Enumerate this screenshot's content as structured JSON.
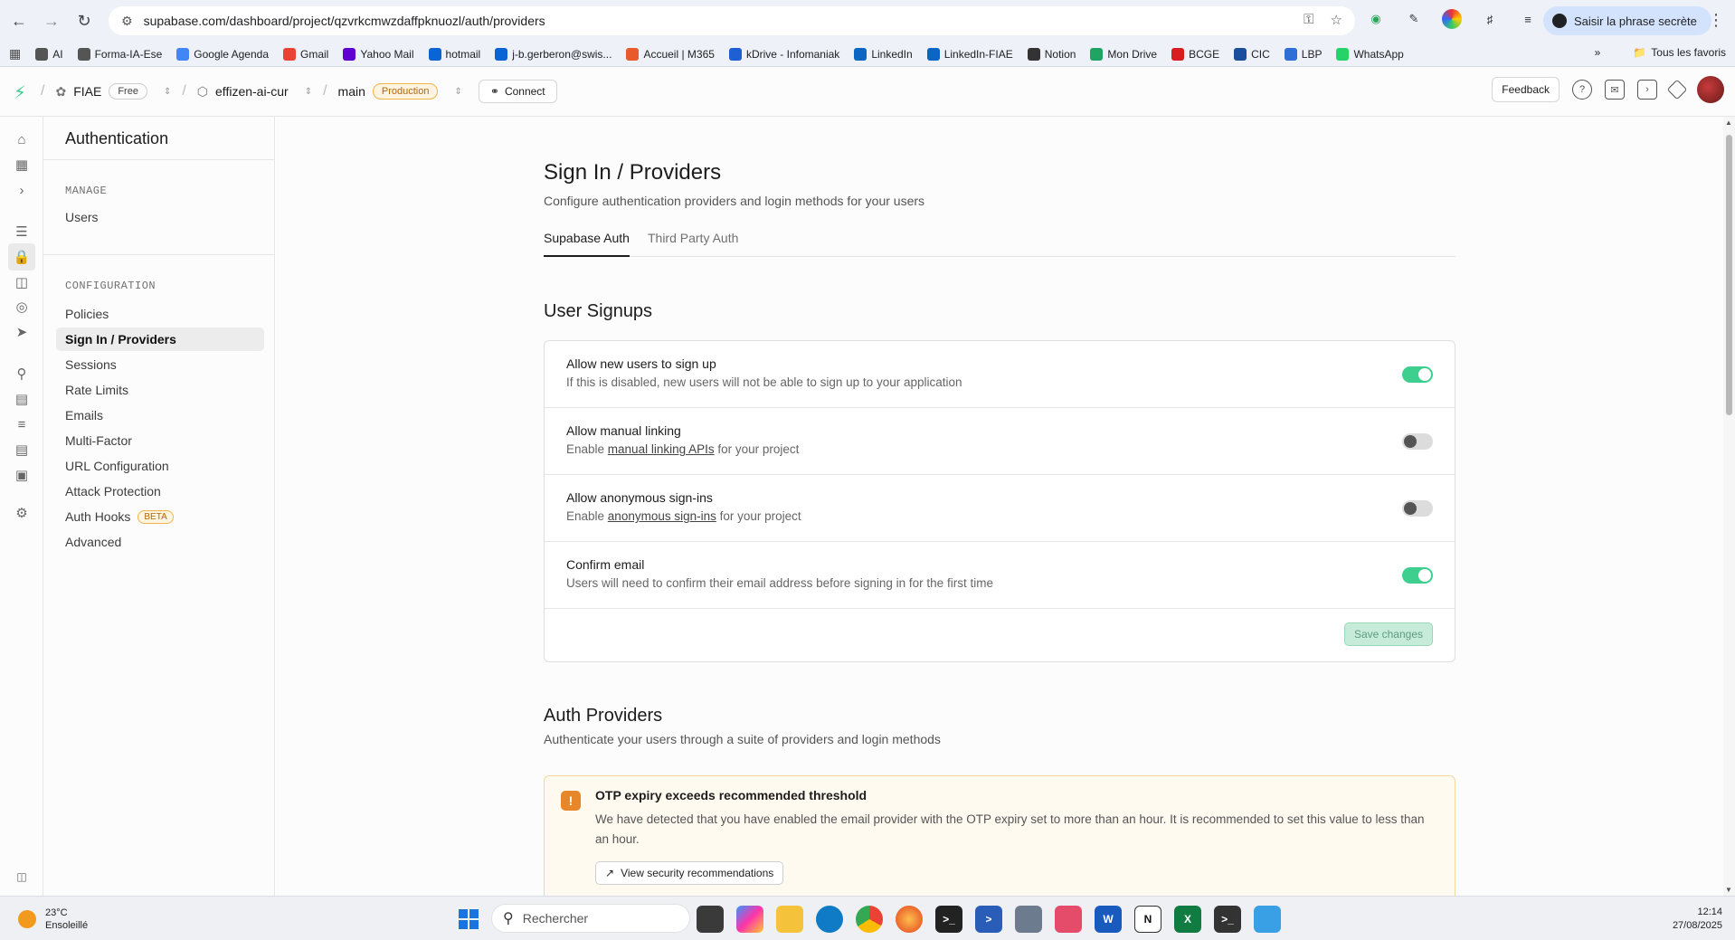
{
  "browser": {
    "url": "supabase.com/dashboard/project/qzvrkcmwzdaffpknuozl/auth/providers",
    "passphrase_button": "Saisir la phrase secrète",
    "bookmarks": [
      {
        "label": "AI",
        "icon": "folder-icon",
        "color": "#555555"
      },
      {
        "label": "Forma-IA-Ese",
        "icon": "folder-icon",
        "color": "#555555"
      },
      {
        "label": "Google Agenda",
        "icon": "calendar-icon",
        "color": "#4285f4"
      },
      {
        "label": "Gmail",
        "icon": "gmail-icon",
        "color": "#ea4335"
      },
      {
        "label": "Yahoo Mail",
        "icon": "mail-icon",
        "color": "#6001d2"
      },
      {
        "label": "hotmail",
        "icon": "outlook-icon",
        "color": "#0a64d6"
      },
      {
        "label": "j-b.gerberon@swis...",
        "icon": "outlook-icon",
        "color": "#0a64d6"
      },
      {
        "label": "Accueil | M365",
        "icon": "m365-icon",
        "color": "#e85a2b"
      },
      {
        "label": "kDrive - Infomaniak",
        "icon": "kdrive-icon",
        "color": "#1e5fd6"
      },
      {
        "label": "LinkedIn",
        "icon": "linkedin-icon",
        "color": "#0a66c2"
      },
      {
        "label": "LinkedIn-FIAE",
        "icon": "linkedin-icon",
        "color": "#0a66c2"
      },
      {
        "label": "Notion",
        "icon": "home-icon",
        "color": "#333333"
      },
      {
        "label": "Mon Drive",
        "icon": "drive-icon",
        "color": "#1fa463"
      },
      {
        "label": "BCGE",
        "icon": "bank-icon",
        "color": "#d81e1e"
      },
      {
        "label": "CIC",
        "icon": "bank-icon",
        "color": "#1b4f9c"
      },
      {
        "label": "LBP",
        "icon": "bank-icon",
        "color": "#2d6fd6"
      },
      {
        "label": "WhatsApp",
        "icon": "whatsapp-icon",
        "color": "#25d366"
      }
    ],
    "all_bookmarks": "Tous les favoris"
  },
  "header": {
    "org": "FIAE",
    "org_plan": "Free",
    "project": "effizen-ai-cur",
    "branch": "main",
    "branch_env": "Production",
    "connect": "Connect",
    "feedback": "Feedback"
  },
  "sidebar": {
    "title": "Authentication",
    "manage_label": "MANAGE",
    "manage_items": [
      "Users"
    ],
    "config_label": "CONFIGURATION",
    "config_items": [
      "Policies",
      "Sign In / Providers",
      "Sessions",
      "Rate Limits",
      "Emails",
      "Multi-Factor",
      "URL Configuration",
      "Attack Protection",
      "Auth Hooks",
      "Advanced"
    ],
    "beta_badge": "BETA",
    "active_item": "Sign In / Providers"
  },
  "page": {
    "title": "Sign In / Providers",
    "subtitle": "Configure authentication providers and login methods for your users",
    "tabs": [
      "Supabase Auth",
      "Third Party Auth"
    ],
    "active_tab": "Supabase Auth"
  },
  "user_signups": {
    "title": "User Signups",
    "rows": [
      {
        "label": "Allow new users to sign up",
        "desc_pre": "If this is disabled, new users will not be able to sign up to your application",
        "link": "",
        "desc_post": "",
        "enabled": true
      },
      {
        "label": "Allow manual linking",
        "desc_pre": "Enable ",
        "link": "manual linking APIs",
        "desc_post": " for your project",
        "enabled": false
      },
      {
        "label": "Allow anonymous sign-ins",
        "desc_pre": "Enable ",
        "link": "anonymous sign-ins",
        "desc_post": " for your project",
        "enabled": false
      },
      {
        "label": "Confirm email",
        "desc_pre": "Users will need to confirm their email address before signing in for the first time",
        "link": "",
        "desc_post": "",
        "enabled": true
      }
    ],
    "save_button": "Save changes"
  },
  "auth_providers": {
    "title": "Auth Providers",
    "subtitle": "Authenticate your users through a suite of providers and login methods",
    "alert": {
      "title": "OTP expiry exceeds recommended threshold",
      "text": "We have detected that you have enabled the email provider with the OTP expiry set to more than an hour. It is recommended to set this value to less than an hour.",
      "button": "View security recommendations"
    }
  },
  "taskbar": {
    "temperature": "23°C",
    "weather": "Ensoleillé",
    "search_placeholder": "Rechercher",
    "time": "12:14",
    "date": "27/08/2025"
  },
  "colors": {
    "brand": "#3ecf8e",
    "warning": "#e8862a"
  }
}
